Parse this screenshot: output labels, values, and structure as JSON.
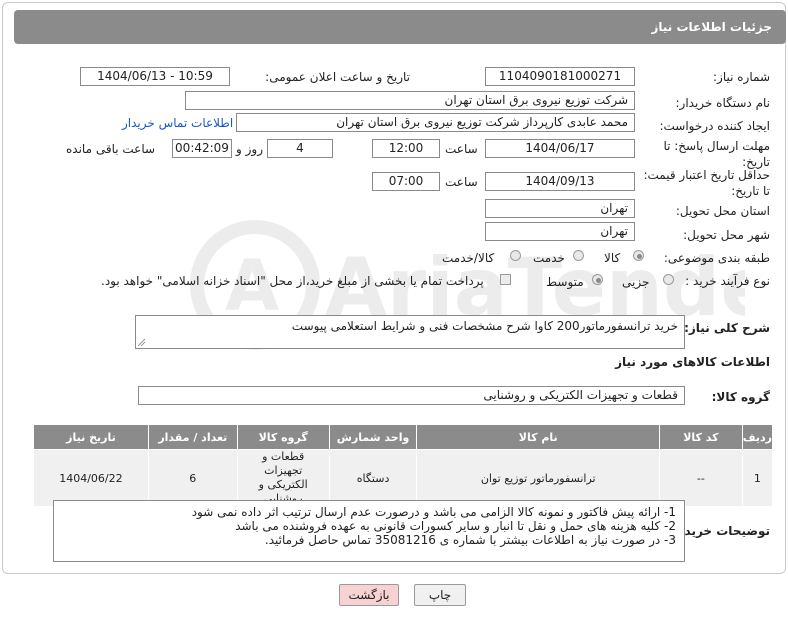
{
  "header": {
    "title": "جزئیات اطلاعات نیاز"
  },
  "form": {
    "need_number_label": "شماره نیاز:",
    "need_number": "1104090181000271",
    "announce_label": "تاریخ و ساعت اعلان عمومی:",
    "announce_value": "1404/06/13 - 10:59",
    "buyer_org_label": "نام دستگاه خریدار:",
    "buyer_org": "شرکت توزیع نیروی برق استان تهران",
    "creator_label": "ایجاد کننده درخواست:",
    "creator": "محمد عابدی کارپرداز شرکت توزیع نیروی برق استان تهران",
    "contact_link": "اطلاعات تماس خریدار",
    "deadline_label": "مهلت ارسال پاسخ: تا تاریخ:",
    "deadline_date": "1404/06/17",
    "time_label": "ساعت",
    "deadline_time": "12:00",
    "days_value": "4",
    "days_label": "روز و",
    "remaining_value": "00:42:09",
    "remaining_label": "ساعت باقی مانده",
    "validity_label": "حداقل تاریخ اعتبار قیمت: تا تاریخ:",
    "validity_date": "1404/09/13",
    "validity_time": "07:00",
    "province_label": "استان محل تحویل:",
    "province": "تهران",
    "city_label": "شهر محل تحویل:",
    "city": "تهران",
    "category_label": "طبقه بندی موضوعی:",
    "category_options": [
      "کالا",
      "خدمت",
      "کالا/خدمت"
    ],
    "purchase_type_label": "نوع فرآیند خرید :",
    "purchase_options": [
      "جزیی",
      "متوسط"
    ],
    "payment_note": "پرداخت تمام یا بخشی از مبلغ خرید،از محل \"اسناد خزانه اسلامی\" خواهد بود."
  },
  "description": {
    "label": "شرح کلی نیاز:",
    "text": "خرید ترانسفورماتور200 کاوا شرح مشخصات فنی و شرایط استعلامی پیوست"
  },
  "goods": {
    "section_title": "اطلاعات کالاهای مورد نیاز",
    "group_label": "گروه کالا:",
    "group_value": "قطعات و تجهیزات الکتریکی و روشنایی",
    "columns": [
      "ردیف",
      "کد کالا",
      "نام کالا",
      "واحد شمارش",
      "گروه کالا",
      "تعداد / مقدار",
      "تاریخ نیاز"
    ],
    "rows": [
      {
        "row": "1",
        "code": "--",
        "name": "ترانسفورماتور توزیع توان",
        "unit": "دستگاه",
        "group": "قطعات و تجهیزات الکتریکی و روشنایی",
        "qty": "6",
        "date": "1404/06/22"
      }
    ]
  },
  "buyer_notes": {
    "label": "توضیحات خریدار:",
    "lines": [
      "1- ارائه پیش فاکتور و نمونه کالا الزامی می باشد و درصورت عدم ارسال ترتیب اثر داده نمی شود",
      "2- کلیه هزینه های حمل و نقل تا انبار و سایر کسورات قانونی به عهده فروشنده می باشد",
      "3- در صورت نیاز به اطلاعات بیشتر با شماره ی 35081216 تماس حاصل فرمائید."
    ]
  },
  "buttons": {
    "print": "چاپ",
    "back": "بازگشت"
  },
  "colors": {
    "header_bg": "#8b8b8b",
    "link": "#1a57c8",
    "back_btn": "#f6d2d2",
    "print_btn": "#f0f0f0"
  }
}
